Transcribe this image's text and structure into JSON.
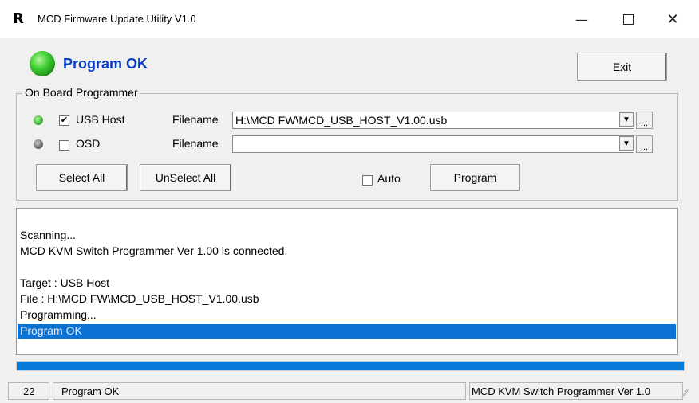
{
  "window": {
    "app_icon": "R",
    "title": "MCD Firmware Update Utility V1.0",
    "minimize_glyph": "—",
    "close_glyph": "✕"
  },
  "status": {
    "led_icon": "green-led",
    "text": "Program OK",
    "text_color": "#0a3ec9"
  },
  "exit_label": "Exit",
  "group": {
    "title": "On Board Programmer",
    "rows": [
      {
        "label": "USB Host",
        "checked": true,
        "check_glyph": "✔",
        "led": "green-led",
        "filename_label": "Filename",
        "filename": "H:\\MCD FW\\MCD_USB_HOST_V1.00.usb"
      },
      {
        "label": "OSD",
        "checked": false,
        "check_glyph": "",
        "led": "gray-led",
        "filename_label": "Filename",
        "filename": ""
      }
    ],
    "dropdown_glyph": "▼",
    "browse_glyph": "...",
    "select_all_label": "Select All",
    "unselect_all_label": "UnSelect All",
    "auto_label": "Auto",
    "auto_checked": false,
    "program_label": "Program"
  },
  "log": {
    "lines": [
      "Scanning...",
      "MCD KVM Switch Programmer Ver 1.00 is connected.",
      "",
      "Target : USB Host",
      "File : H:\\MCD FW\\MCD_USB_HOST_V1.00.usb",
      "Programming...",
      "Program OK"
    ],
    "selected_index": 6,
    "highlight_color": "#0a73d4"
  },
  "progress": {
    "value": 1.0,
    "color": "#0a78d7"
  },
  "statusbar": {
    "count": "22",
    "message": "Program OK",
    "device": "MCD KVM Switch Programmer Ver 1.0",
    "grip_glyph": "⁄⁄"
  }
}
